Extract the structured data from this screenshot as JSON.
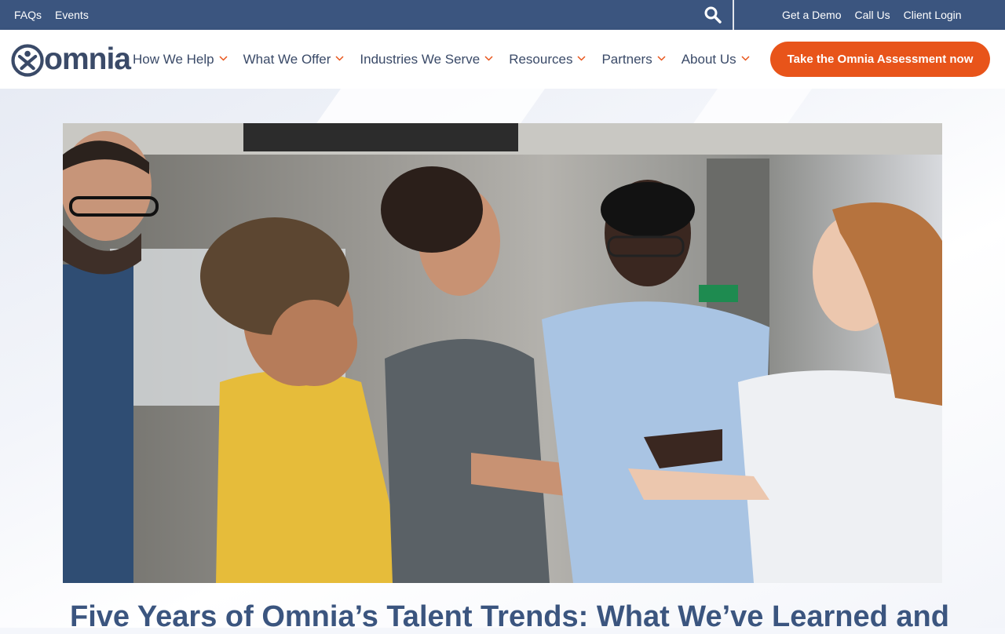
{
  "utility": {
    "left_links": [
      "FAQs",
      "Events"
    ],
    "right_links": [
      "Get a Demo",
      "Call Us",
      "Client Login"
    ],
    "search_icon": "search-icon"
  },
  "brand": {
    "name": "omnia",
    "primary_color": "#3b557f",
    "accent_color": "#e8541a"
  },
  "nav": {
    "items": [
      {
        "label": "How We Help"
      },
      {
        "label": "What We Offer"
      },
      {
        "label": "Industries We Serve"
      },
      {
        "label": "Resources"
      },
      {
        "label": "Partners"
      },
      {
        "label": "About Us"
      }
    ],
    "cta_label": "Take the Omnia Assessment now"
  },
  "hero": {
    "image_icon": "photo-icon"
  },
  "article": {
    "title": "Five Years of Omnia’s Talent Trends: What We’ve Learned and"
  }
}
